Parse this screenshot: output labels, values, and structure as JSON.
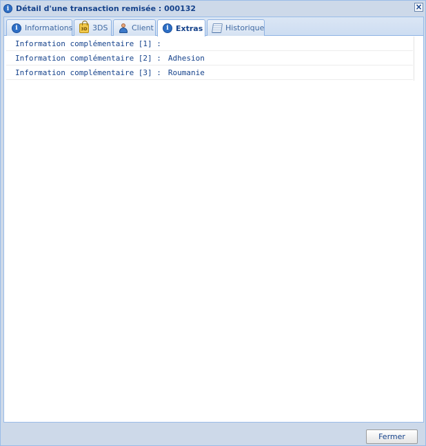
{
  "window": {
    "title": "Détail d'une transaction remisée : 000132",
    "title_icon": "info-icon",
    "close_icon": "close-icon",
    "close_glyph": "×"
  },
  "tabs": [
    {
      "label": "Informations",
      "icon": "info-icon",
      "active": false
    },
    {
      "label": "3DS",
      "icon": "lock-3d-icon",
      "icon_text": "3D",
      "active": false
    },
    {
      "label": "Client",
      "icon": "user-icon",
      "active": false
    },
    {
      "label": "Extras",
      "icon": "info-icon",
      "active": true
    },
    {
      "label": "Historique",
      "icon": "document-icon",
      "active": false
    }
  ],
  "extras": [
    {
      "label": "Information complémentaire [1] :",
      "value": ""
    },
    {
      "label": "Information complémentaire [2] :",
      "value": "Adhesion"
    },
    {
      "label": "Information complémentaire [3] :",
      "value": "Roumanie"
    }
  ],
  "footer": {
    "close_button_label": "Fermer"
  },
  "colors": {
    "window_bg": "#cdd9e9",
    "text": "#15428b",
    "border": "#99bbe8"
  }
}
